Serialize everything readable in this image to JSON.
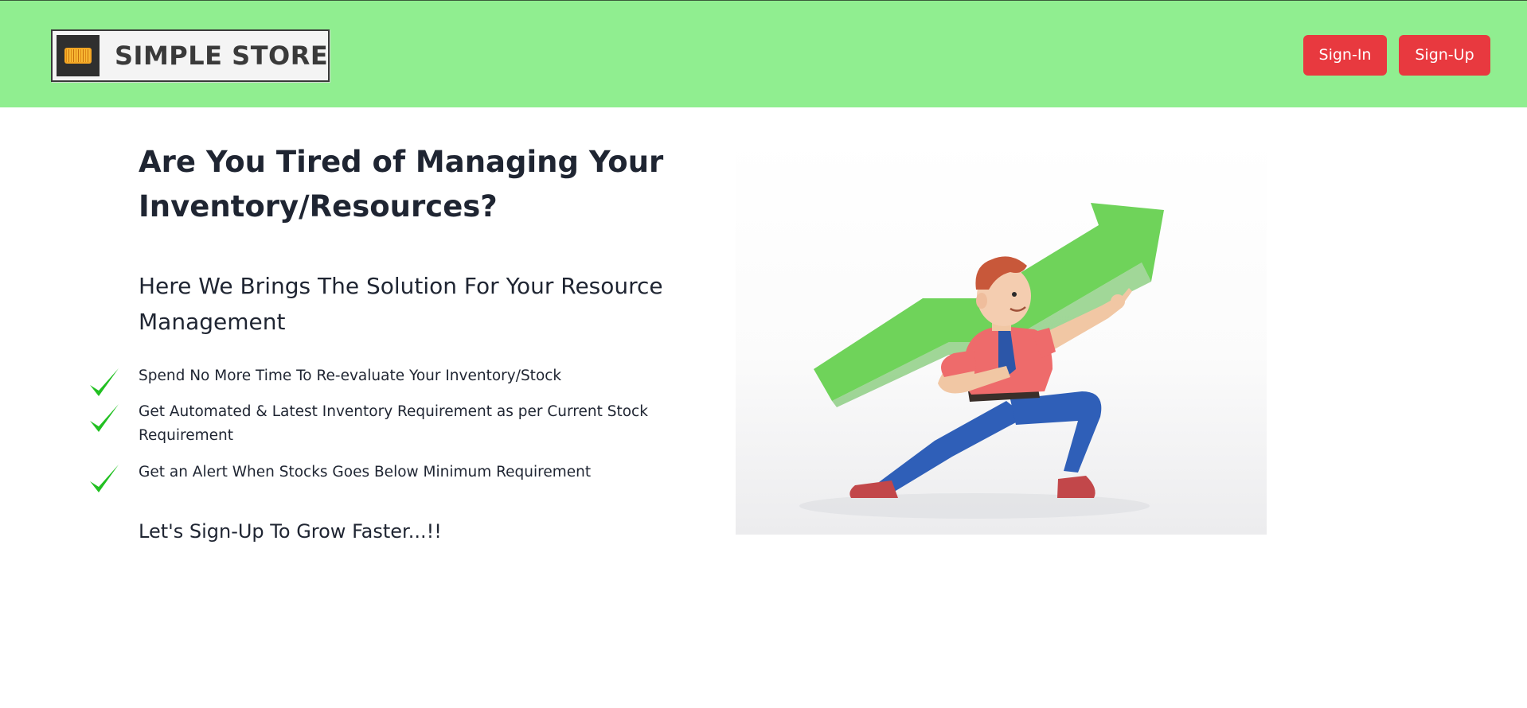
{
  "header": {
    "brand_name": "SIMPLE STORE",
    "signin_label": "Sign-In",
    "signup_label": "Sign-Up"
  },
  "hero": {
    "title": "Are You Tired of Managing Your Inventory/Resources?",
    "subtitle": "Here We Brings The Solution For Your Resource Management",
    "features": [
      {
        "icon": "check-icon",
        "text": "Spend No More Time To Re-evaluate Your Inventory/Stock"
      },
      {
        "icon": "check-icon",
        "text": "Get Automated & Latest Inventory Requirement as per Current Stock Requirement"
      },
      {
        "icon": "check-icon",
        "text": "Get an Alert When Stocks Goes Below Minimum Requirement"
      }
    ],
    "cta": "Let's Sign-Up To Grow Faster...!!"
  },
  "colors": {
    "header_background": "#90ee90",
    "button_background": "#e8393f",
    "check_color": "#22c022",
    "arrow_color": "#6fd35a",
    "text_color": "#1f2532"
  }
}
